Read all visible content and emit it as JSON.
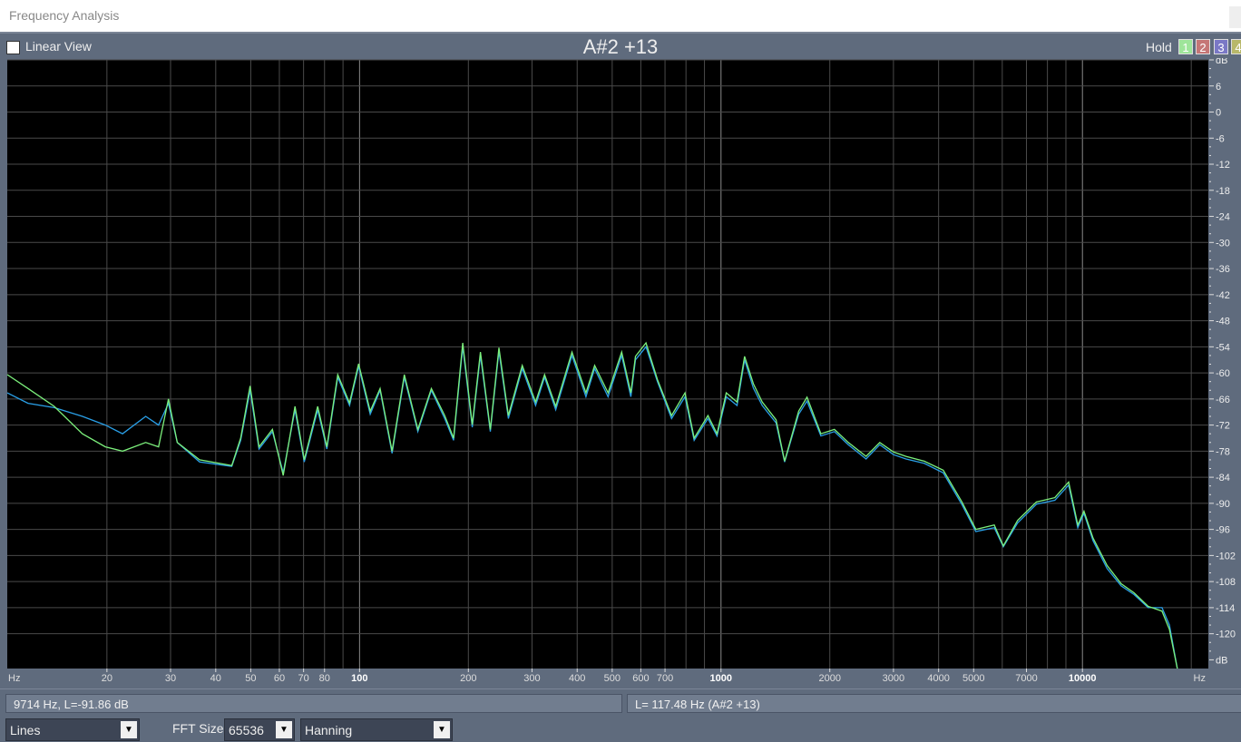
{
  "window": {
    "title": "Frequency Analysis"
  },
  "toolbar": {
    "linear_view": "Linear View",
    "note": "A#2 +13",
    "hold": "Hold",
    "hold_buttons": [
      "1",
      "2",
      "3",
      "4"
    ],
    "hold_colors": [
      "#9ee59a",
      "#c57676",
      "#7a78c6",
      "#b8b86a"
    ]
  },
  "status": {
    "cursor": "9714 Hz, L=-91.86 dB",
    "peak": "L= 117.48 Hz (A#2 +13)"
  },
  "controls": {
    "display_mode": "Lines",
    "fft_label": "FFT Size",
    "fft_size": "65536",
    "window": "Hanning"
  },
  "chart_data": {
    "type": "line",
    "xscale": "log",
    "xlabel": "Hz",
    "ylabel": "dB",
    "xlim": [
      10.6,
      22300
    ],
    "ylim": [
      -128,
      12
    ],
    "xticks": [
      {
        "v": 20,
        "l": "20"
      },
      {
        "v": 30,
        "l": "30"
      },
      {
        "v": 40,
        "l": "40"
      },
      {
        "v": 50,
        "l": "50"
      },
      {
        "v": 60,
        "l": "60"
      },
      {
        "v": 70,
        "l": "70"
      },
      {
        "v": 80,
        "l": "80"
      },
      {
        "v": 100,
        "l": "100"
      },
      {
        "v": 200,
        "l": "200"
      },
      {
        "v": 300,
        "l": "300"
      },
      {
        "v": 400,
        "l": "400"
      },
      {
        "v": 500,
        "l": "500"
      },
      {
        "v": 600,
        "l": "600"
      },
      {
        "v": 700,
        "l": "700"
      },
      {
        "v": 1000,
        "l": "1000"
      },
      {
        "v": 2000,
        "l": "2000"
      },
      {
        "v": 3000,
        "l": "3000"
      },
      {
        "v": 4000,
        "l": "4000"
      },
      {
        "v": 5000,
        "l": "5000"
      },
      {
        "v": 7000,
        "l": "7000"
      },
      {
        "v": 10000,
        "l": "10000"
      }
    ],
    "yticks": [
      6,
      0,
      -6,
      -12,
      -18,
      -24,
      -30,
      -36,
      -42,
      -48,
      -54,
      -60,
      -66,
      -72,
      -78,
      -84,
      -90,
      -96,
      -102,
      -108,
      -114,
      -120
    ],
    "x": [
      10.6,
      12.1,
      14.3,
      17.1,
      19.8,
      22.1,
      25.6,
      27.8,
      29.6,
      31.3,
      36.1,
      44.3,
      46.9,
      49.8,
      52.7,
      57.4,
      61.5,
      66.3,
      70.3,
      76.6,
      81.2,
      87,
      93.8,
      99.4,
      107,
      114,
      123,
      133,
      145,
      158,
      172,
      182,
      193,
      205,
      216,
      230,
      243,
      258,
      282,
      307,
      325,
      349,
      387,
      423,
      447,
      487,
      531,
      563,
      580,
      620,
      667,
      730,
      795,
      843,
      920,
      975,
      1034,
      1108,
      1162,
      1229,
      1300,
      1420,
      1500,
      1640,
      1730,
      1890,
      2060,
      2250,
      2520,
      2750,
      3000,
      3250,
      3650,
      4120,
      4640,
      5070,
      5700,
      6040,
      6620,
      7460,
      8390,
      9160,
      9710,
      10100,
      10700,
      11700,
      12800,
      13900,
      15200,
      16600,
      17400,
      18300
    ],
    "series": [
      {
        "name": "Green",
        "color": "#7cf07c",
        "values": [
          -60.4,
          -63.6,
          -67.7,
          -74,
          -77,
          -78,
          -76,
          -77,
          -66,
          -76,
          -80,
          -81.3,
          -75,
          -63,
          -77,
          -73,
          -83.6,
          -67.7,
          -80,
          -67.7,
          -77,
          -60.4,
          -66.9,
          -57.9,
          -68.8,
          -63.6,
          -78,
          -60.4,
          -73,
          -63.6,
          -69.8,
          -75,
          -53.1,
          -71.9,
          -55.2,
          -73,
          -54.2,
          -69.8,
          -58.3,
          -66.7,
          -60.4,
          -67.7,
          -55.2,
          -64.6,
          -58.3,
          -64.6,
          -55.2,
          -64.6,
          -56.2,
          -53.1,
          -61.5,
          -69.8,
          -64.6,
          -75,
          -69.8,
          -74,
          -64.6,
          -66.7,
          -56.2,
          -62.5,
          -66.7,
          -70.8,
          -80.3,
          -68.8,
          -65.6,
          -74,
          -73,
          -76,
          -79.2,
          -76,
          -78.2,
          -79.2,
          -80.3,
          -82.4,
          -89.7,
          -96,
          -95,
          -99.8,
          -93.9,
          -89.7,
          -88.7,
          -85.1,
          -95,
          -91.8,
          -98,
          -104.3,
          -108.5,
          -110.6,
          -113.7,
          -114.8,
          -119,
          -128
        ]
      },
      {
        "name": "Blue",
        "color": "#2aa0e8",
        "values": [
          -64.6,
          -67,
          -68,
          -70,
          -72,
          -74,
          -70,
          -72,
          -67,
          -76,
          -80.5,
          -81.5,
          -75.5,
          -64,
          -77.5,
          -73.5,
          -83,
          -68.5,
          -80.5,
          -68.5,
          -77.5,
          -61,
          -67.5,
          -58.5,
          -69.5,
          -64,
          -78.5,
          -61,
          -73.5,
          -64,
          -70.5,
          -75.5,
          -54,
          -72.5,
          -56,
          -73.5,
          -55,
          -70.5,
          -59,
          -67.5,
          -61,
          -68.5,
          -56,
          -65.5,
          -59,
          -65.5,
          -56,
          -65.5,
          -57,
          -54,
          -62,
          -70.5,
          -65.5,
          -75.5,
          -70.5,
          -74.5,
          -65.5,
          -67.5,
          -57,
          -63.5,
          -67.5,
          -71.5,
          -80.5,
          -69.5,
          -66.5,
          -74.5,
          -73.5,
          -76.5,
          -79.8,
          -76.5,
          -78.8,
          -79.8,
          -80.8,
          -83,
          -90.3,
          -96.5,
          -95.6,
          -100,
          -94.5,
          -90.2,
          -89.3,
          -85.8,
          -95.6,
          -92.3,
          -98.6,
          -105,
          -109,
          -111,
          -114,
          -114,
          -118,
          -128
        ]
      }
    ]
  }
}
